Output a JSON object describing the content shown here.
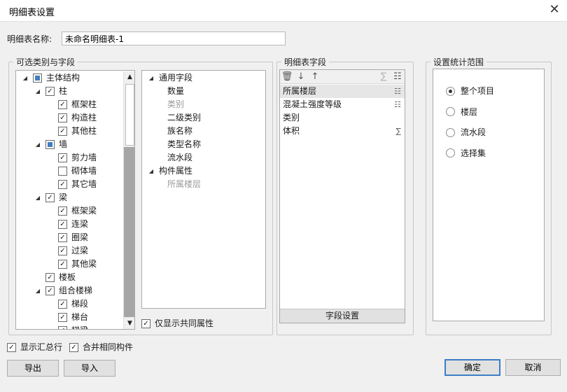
{
  "window": {
    "title": "明细表设置",
    "close_glyph": "✕"
  },
  "name_field": {
    "label": "明细表名称:",
    "value": "未命名明细表-1"
  },
  "categories_group": {
    "legend": "可选类别与字段",
    "tree": [
      {
        "label": "主体结构",
        "level": 0,
        "expander": "◢",
        "state": "partial"
      },
      {
        "label": "柱",
        "level": 1,
        "expander": "◢",
        "state": "checked"
      },
      {
        "label": "框架柱",
        "level": 2,
        "expander": "",
        "state": "checked"
      },
      {
        "label": "构造柱",
        "level": 2,
        "expander": "",
        "state": "checked"
      },
      {
        "label": "其他柱",
        "level": 2,
        "expander": "",
        "state": "checked"
      },
      {
        "label": "墙",
        "level": 1,
        "expander": "◢",
        "state": "partial"
      },
      {
        "label": "剪力墙",
        "level": 2,
        "expander": "",
        "state": "checked"
      },
      {
        "label": "砌体墙",
        "level": 2,
        "expander": "",
        "state": "unchecked"
      },
      {
        "label": "其它墙",
        "level": 2,
        "expander": "",
        "state": "checked"
      },
      {
        "label": "梁",
        "level": 1,
        "expander": "◢",
        "state": "checked"
      },
      {
        "label": "框架梁",
        "level": 2,
        "expander": "",
        "state": "checked"
      },
      {
        "label": "连梁",
        "level": 2,
        "expander": "",
        "state": "checked"
      },
      {
        "label": "圈梁",
        "level": 2,
        "expander": "",
        "state": "checked"
      },
      {
        "label": "过梁",
        "level": 2,
        "expander": "",
        "state": "checked"
      },
      {
        "label": "其他梁",
        "level": 2,
        "expander": "",
        "state": "checked"
      },
      {
        "label": "楼板",
        "level": 1,
        "expander": "",
        "state": "checked"
      },
      {
        "label": "组合楼梯",
        "level": 1,
        "expander": "◢",
        "state": "checked"
      },
      {
        "label": "梯段",
        "level": 2,
        "expander": "",
        "state": "checked"
      },
      {
        "label": "梯台",
        "level": 2,
        "expander": "",
        "state": "checked"
      },
      {
        "label": "梯梁",
        "level": 2,
        "expander": "",
        "state": "checked"
      }
    ],
    "scroll_up": "▲",
    "scroll_down": "▼",
    "fields_tree": [
      {
        "label": "通用字段",
        "level": 0,
        "expander": "◢",
        "enabled": true
      },
      {
        "label": "数量",
        "level": 1,
        "expander": "",
        "enabled": true
      },
      {
        "label": "类别",
        "level": 1,
        "expander": "",
        "enabled": false
      },
      {
        "label": "二级类别",
        "level": 1,
        "expander": "",
        "enabled": true
      },
      {
        "label": "族名称",
        "level": 1,
        "expander": "",
        "enabled": true
      },
      {
        "label": "类型名称",
        "level": 1,
        "expander": "",
        "enabled": true
      },
      {
        "label": "流水段",
        "level": 1,
        "expander": "",
        "enabled": true
      },
      {
        "label": "构件属性",
        "level": 0,
        "expander": "◢",
        "enabled": true
      },
      {
        "label": "所属楼层",
        "level": 1,
        "expander": "",
        "enabled": false
      }
    ],
    "common_only": {
      "label": "仅显示共同属性",
      "checked": true
    }
  },
  "schedule_fields_group": {
    "legend": "明细表字段",
    "toolbar": {
      "delete_glyph": "🗑",
      "down_glyph": "↓",
      "up_glyph": "↑",
      "sum_glyph": "∑",
      "group_glyph": "☷"
    },
    "fields": [
      {
        "label": "所属楼层",
        "icon": "group",
        "glyph": "☷",
        "selected": true
      },
      {
        "label": "混凝土强度等级",
        "icon": "group",
        "glyph": "☷",
        "selected": false
      },
      {
        "label": "类别",
        "icon": "",
        "glyph": "",
        "selected": false
      },
      {
        "label": "体积",
        "icon": "sum",
        "glyph": "∑",
        "selected": false
      }
    ],
    "settings_button": "字段设置"
  },
  "scope_group": {
    "legend": "设置统计范围",
    "options": [
      {
        "label": "整个项目",
        "selected": true
      },
      {
        "label": "楼层",
        "selected": false
      },
      {
        "label": "流水段",
        "selected": false
      },
      {
        "label": "选择集",
        "selected": false
      }
    ]
  },
  "bottom_options": {
    "show_total": {
      "label": "显示汇总行",
      "checked": true
    },
    "merge_same": {
      "label": "合并相同构件",
      "checked": true
    }
  },
  "buttons": {
    "export": "导出",
    "import": "导入",
    "ok": "确定",
    "cancel": "取消"
  }
}
